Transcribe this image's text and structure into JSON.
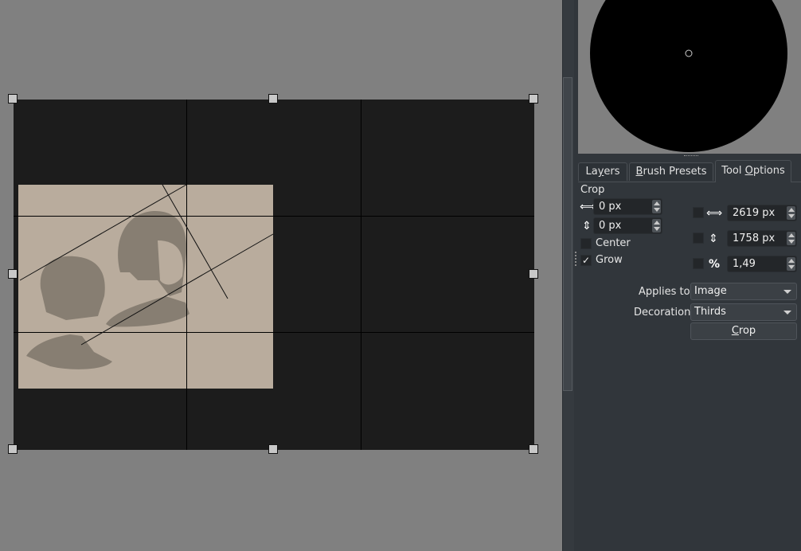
{
  "canvas": {
    "decoration_mode": "Thirds"
  },
  "preview": {
    "brush_shape": "circle"
  },
  "tabs": [
    {
      "label_pre": "La",
      "label_ul": "y",
      "label_post": "ers",
      "active": false
    },
    {
      "label_pre": "",
      "label_ul": "B",
      "label_post": "rush Presets",
      "active": false
    },
    {
      "label_pre": "Tool ",
      "label_ul": "O",
      "label_post": "ptions",
      "active": true
    }
  ],
  "tool_options": {
    "section_title": "Crop",
    "x_offset": {
      "icon": "horizontal-move-icon",
      "value": "0 px"
    },
    "y_offset": {
      "icon": "vertical-move-icon",
      "value": "0 px"
    },
    "center": {
      "label": "Center",
      "checked": false
    },
    "grow": {
      "label": "Grow",
      "checked": true,
      "check_glyph": "✓"
    },
    "width": {
      "icon": "width-icon",
      "value": "2619 px",
      "locked": false
    },
    "height": {
      "icon": "height-icon",
      "value": "1758 px",
      "locked": false
    },
    "ratio": {
      "icon": "percent-icon",
      "glyph": "%",
      "value": "1,49",
      "locked": false
    },
    "applies_to": {
      "label": "Applies to:",
      "value": "Image"
    },
    "decoration": {
      "label": "Decoration:",
      "value": "Thirds"
    },
    "crop_button": {
      "label_ul": "C",
      "label_post": "rop"
    }
  }
}
